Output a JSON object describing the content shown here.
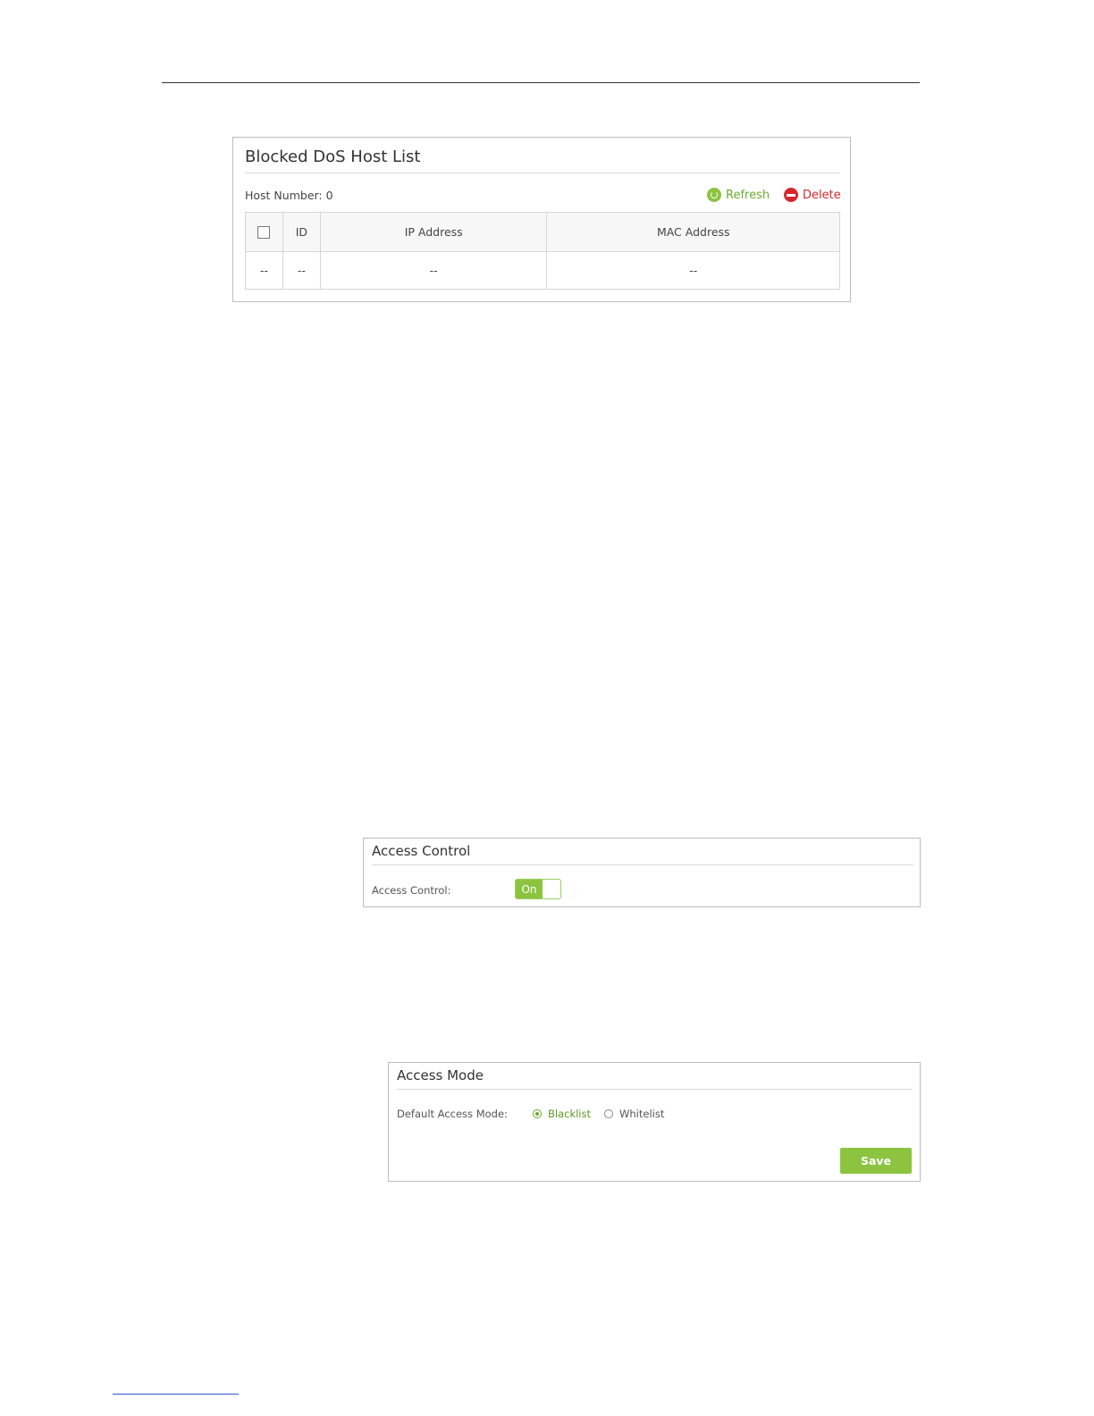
{
  "blocked_dos": {
    "title": "Blocked DoS Host List",
    "host_number_label": "Host Number:",
    "host_number_value": "0",
    "refresh_label": "Refresh",
    "delete_label": "Delete",
    "columns": [
      "",
      "ID",
      "IP Address",
      "MAC Address"
    ],
    "rows": [
      [
        "--",
        "--",
        "--",
        "--"
      ]
    ]
  },
  "access_control": {
    "title": "Access Control",
    "field_label": "Access Control:",
    "toggle_label": "On"
  },
  "access_mode": {
    "title": "Access Mode",
    "field_label": "Default Access Mode:",
    "options": [
      "Blacklist",
      "Whitelist"
    ],
    "selected": "Blacklist",
    "save_label": "Save"
  },
  "colors": {
    "accent_green": "#8cc43f",
    "delete_red": "#d7262b"
  }
}
